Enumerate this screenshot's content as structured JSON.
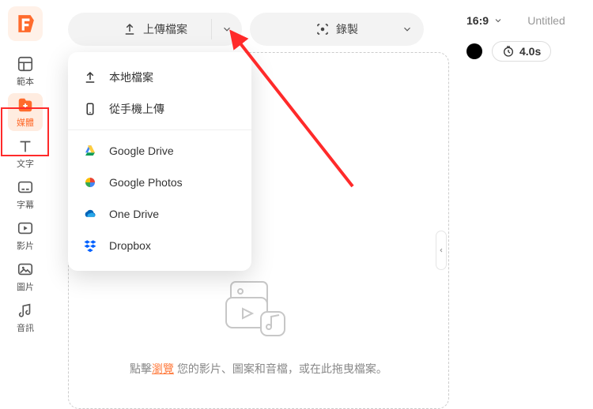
{
  "sidebar": {
    "items": [
      {
        "label": "範本"
      },
      {
        "label": "媒體"
      },
      {
        "label": "文字"
      },
      {
        "label": "字幕"
      },
      {
        "label": "影片"
      },
      {
        "label": "圖片"
      },
      {
        "label": "音訊"
      }
    ]
  },
  "toolbar": {
    "upload_label": "上傳檔案",
    "record_label": "錄製"
  },
  "dropdown": {
    "local": "本地檔案",
    "phone": "從手機上傳",
    "gdrive": "Google Drive",
    "gphotos": "Google Photos",
    "onedrive": "One Drive",
    "dropbox": "Dropbox"
  },
  "dropzone": {
    "prefix": "點擊",
    "link": "瀏覽",
    "middle": "您的影片、圖案和音檔，或在此拖曳檔案。"
  },
  "right": {
    "ratio": "16:9",
    "title": "Untitled",
    "duration": "4.0s"
  }
}
